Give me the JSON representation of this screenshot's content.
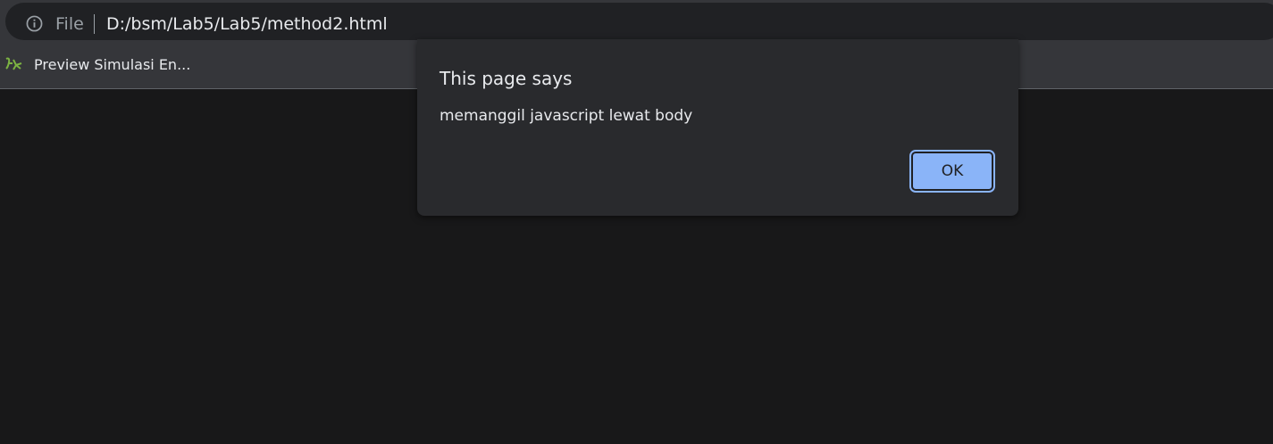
{
  "omnibox": {
    "scheme_label": "File",
    "url": "D:/bsm/Lab5/Lab5/method2.html",
    "site_info_icon": "info-icon"
  },
  "bookmarks_bar": {
    "items": [
      {
        "label": "Preview Simulasi En...",
        "icon": "bookmark-favicon"
      }
    ]
  },
  "alert_dialog": {
    "title": "This page says",
    "message": "memanggil javascript lewat body",
    "ok_label": "OK"
  },
  "colors": {
    "page_background": "#181819",
    "toolbar": "#35363a",
    "dialog": "#292a2d",
    "accent": "#8ab4f8",
    "favicon": "#7cb342"
  }
}
